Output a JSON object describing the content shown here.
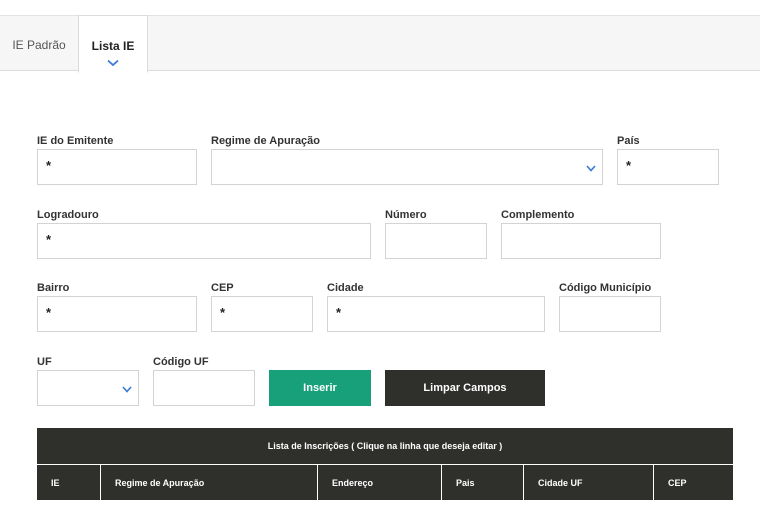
{
  "tabs": [
    {
      "label": "IE Padrão",
      "active": false
    },
    {
      "label": "Lista IE",
      "active": true
    }
  ],
  "form": {
    "ie_emitente": {
      "label": "IE do Emitente",
      "value": "*"
    },
    "regime": {
      "label": "Regime de Apuração",
      "value": ""
    },
    "pais": {
      "label": "País",
      "value": "*"
    },
    "logradouro": {
      "label": "Logradouro",
      "value": "*"
    },
    "numero": {
      "label": "Número",
      "value": ""
    },
    "complemento": {
      "label": "Complemento",
      "value": ""
    },
    "bairro": {
      "label": "Bairro",
      "value": "*"
    },
    "cep": {
      "label": "CEP",
      "value": "*"
    },
    "cidade": {
      "label": "Cidade",
      "value": "*"
    },
    "codigo_municipio": {
      "label": "Código Município",
      "value": ""
    },
    "uf": {
      "label": "UF",
      "value": ""
    },
    "codigo_uf": {
      "label": "Código UF",
      "value": ""
    }
  },
  "buttons": {
    "inserir": "Inserir",
    "limpar": "Limpar Campos"
  },
  "table": {
    "caption": "Lista de Inscrições ( Clique na linha que deseja editar )",
    "columns": [
      "IE",
      "Regime de Apuração",
      "Endereço",
      "Pais",
      "Cidade UF",
      "CEP"
    ]
  },
  "colors": {
    "accent": "#17a07a",
    "dark": "#2f2f2c",
    "chevron": "#3a7bd5"
  }
}
